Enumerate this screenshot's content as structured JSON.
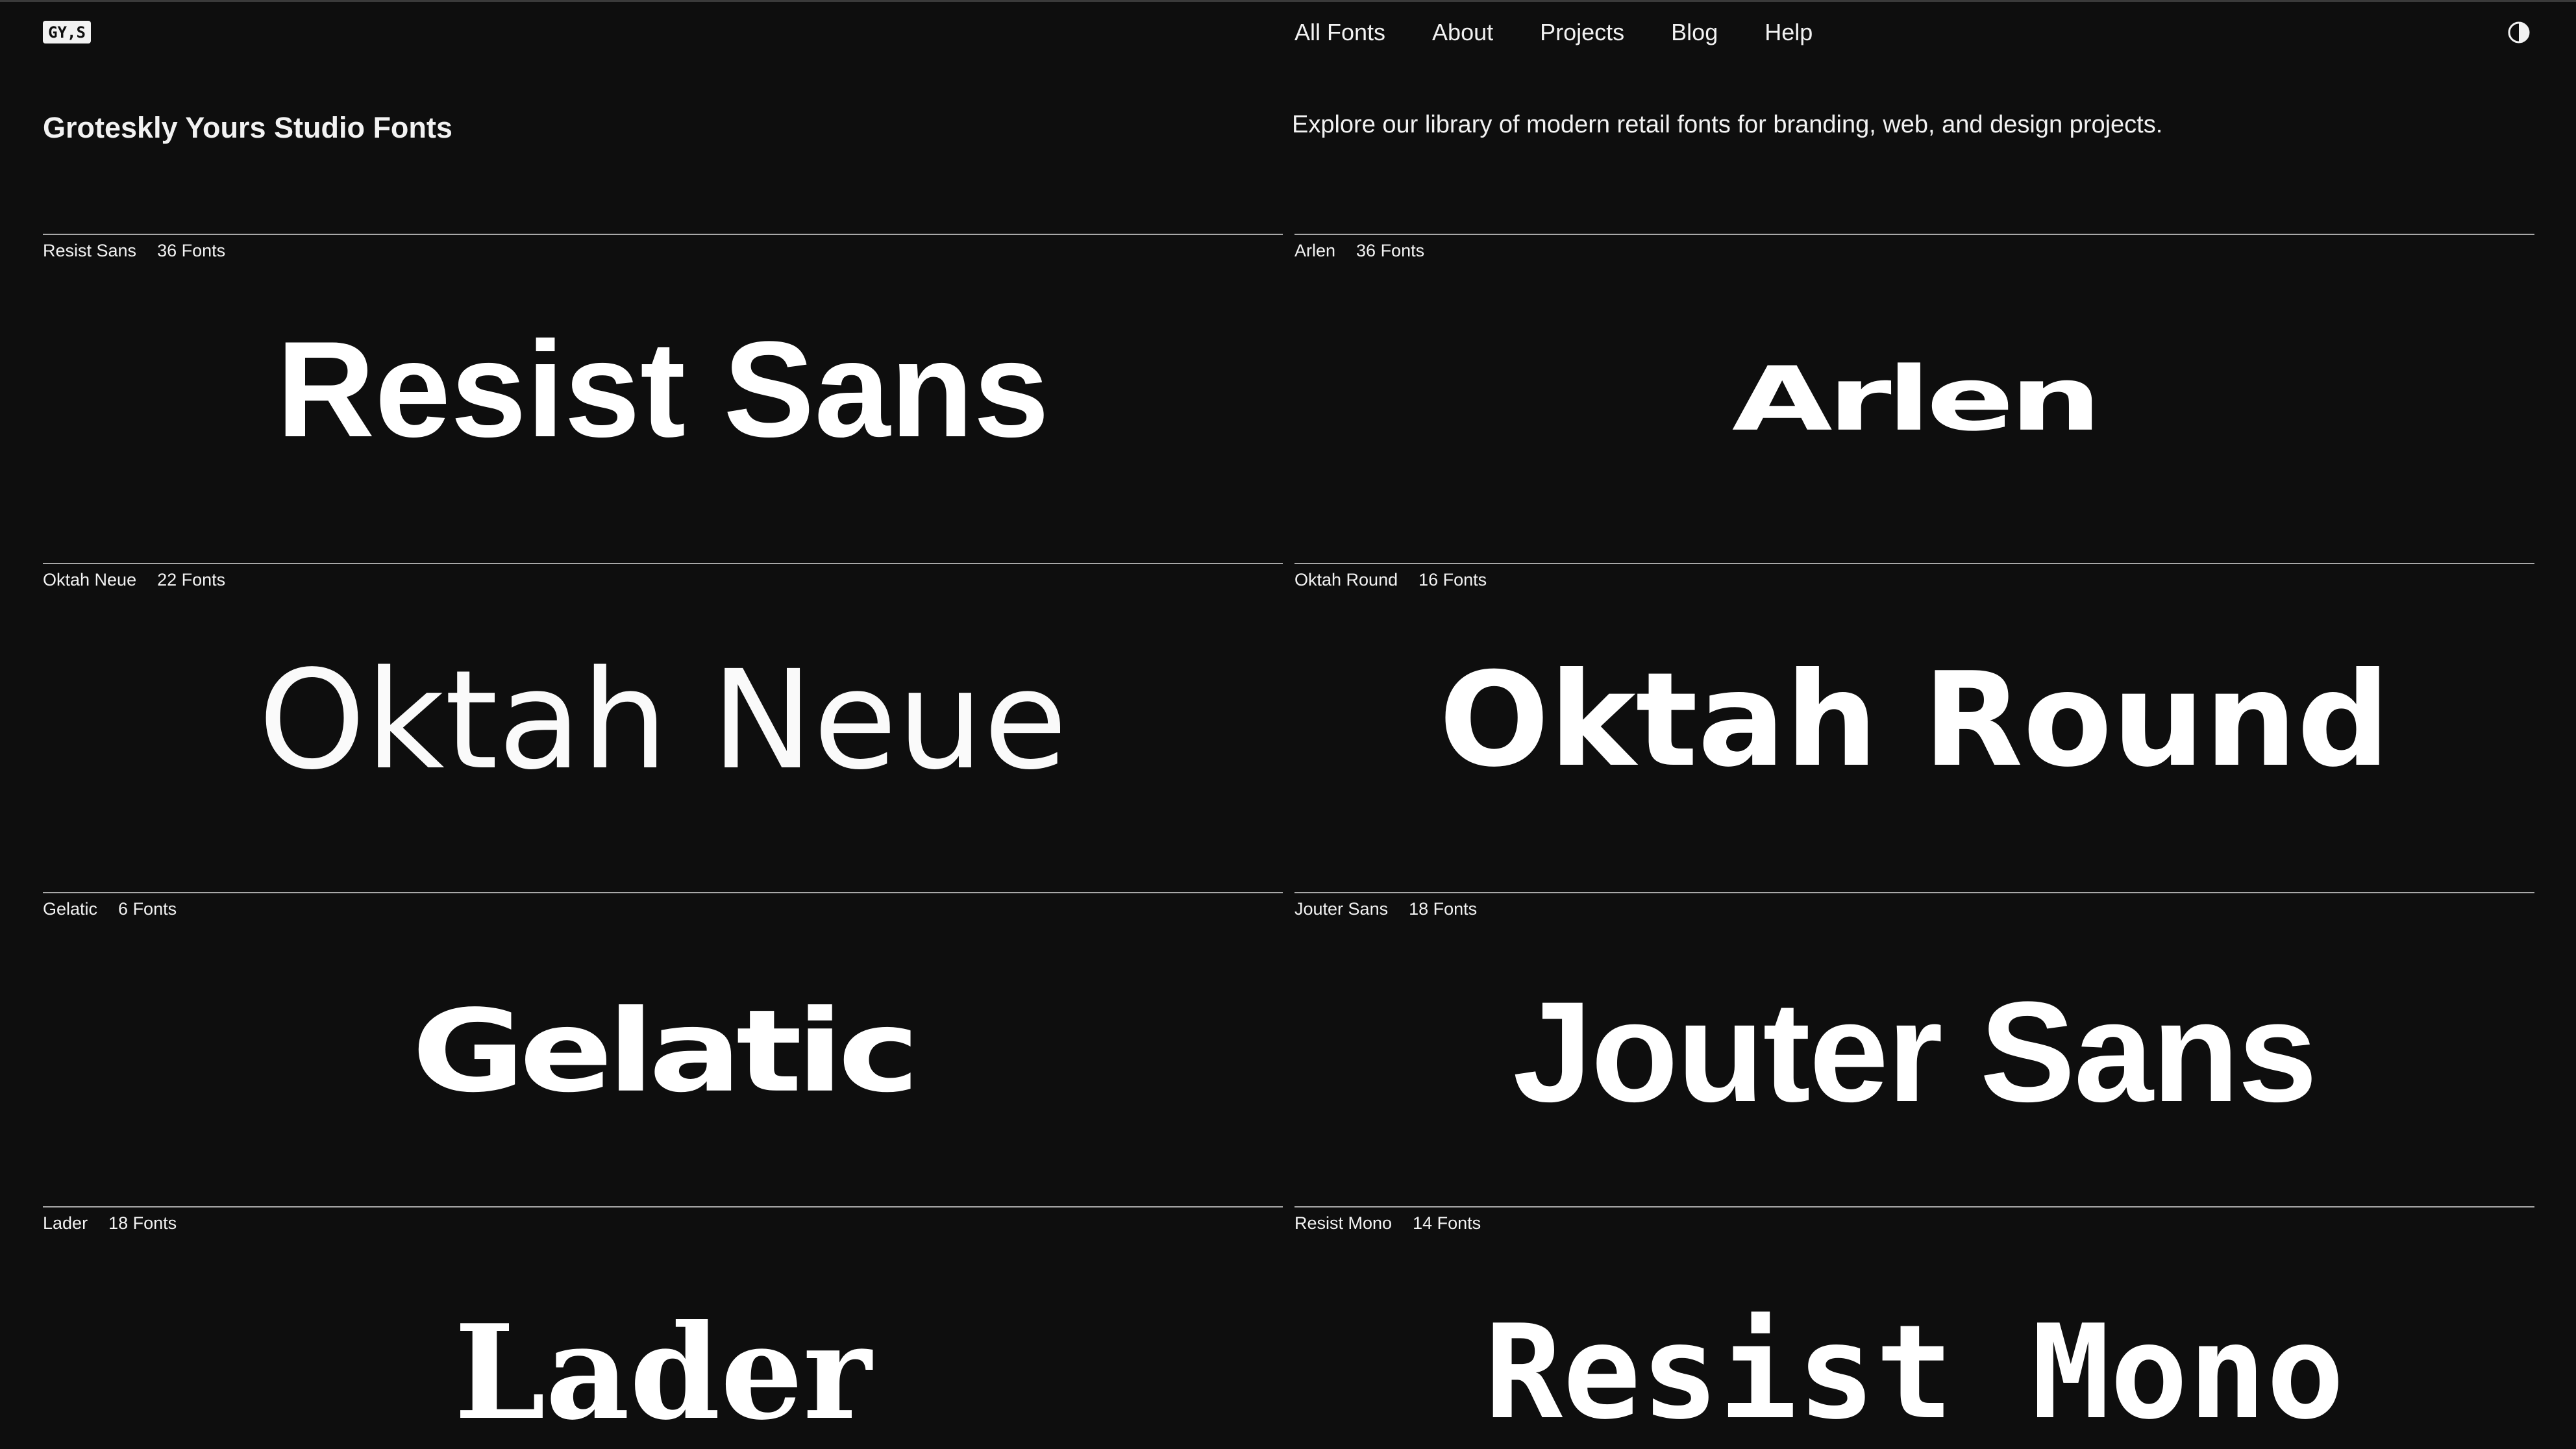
{
  "brand": {
    "logo_text": "GY,S"
  },
  "nav": {
    "items": [
      {
        "label": "All Fonts"
      },
      {
        "label": "About"
      },
      {
        "label": "Projects"
      },
      {
        "label": "Blog"
      },
      {
        "label": "Help"
      }
    ],
    "theme_toggle_icon": "contrast-icon"
  },
  "header": {
    "title": "Groteskly Yours Studio Fonts",
    "intro": "Explore our library of modern retail fonts for branding, web, and design projects."
  },
  "fonts": [
    {
      "name": "Resist Sans",
      "count": "36 Fonts",
      "specimen": "Resist Sans"
    },
    {
      "name": "Arlen",
      "count": "36 Fonts",
      "specimen": "Arlen"
    },
    {
      "name": "Oktah Neue",
      "count": "22 Fonts",
      "specimen": "Oktah Neue"
    },
    {
      "name": "Oktah Round",
      "count": "16 Fonts",
      "specimen": "Oktah Round"
    },
    {
      "name": "Gelatic",
      "count": "6 Fonts",
      "specimen": "Gelatic"
    },
    {
      "name": "Jouter Sans",
      "count": "18 Fonts",
      "specimen": "Jouter Sans"
    },
    {
      "name": "Lader",
      "count": "18 Fonts",
      "specimen": "Lader"
    },
    {
      "name": "Resist Mono",
      "count": "14 Fonts",
      "specimen": "Resist Mono"
    }
  ],
  "colors": {
    "background": "#0e0e0e",
    "text": "#f2f2f2",
    "divider": "#a8a8a8"
  }
}
